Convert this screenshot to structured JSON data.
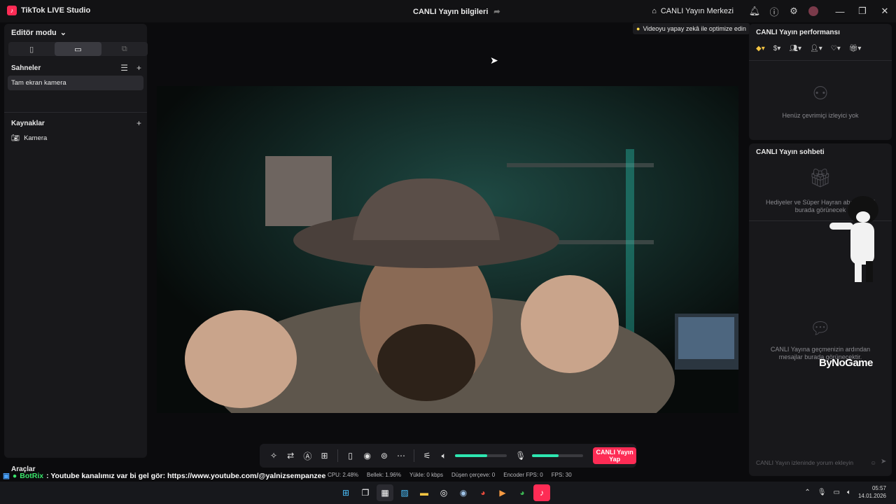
{
  "app": {
    "name": "TikTok LIVE Studio",
    "live_info_title": "CANLI Yayın bilgileri",
    "live_center_label": "CANLI Yayın Merkezi"
  },
  "left": {
    "editor_mode_label": "Editör modu",
    "scenes_label": "Sahneler",
    "scene_items": [
      "Tam ekran kamera"
    ],
    "sources_label": "Kaynaklar",
    "source_items": [
      "Kamera"
    ],
    "tools_label": "Araçlar"
  },
  "preview": {
    "ai_tip": "Videoyu yapay zekâ ile optimize edin"
  },
  "performance": {
    "title": "CANLI Yayın performansı",
    "empty_viewers": "Henüz çevrimiçi izleyici yok"
  },
  "chat": {
    "title": "CANLI Yayın sohbeti",
    "gifts_msg": "Hediyeler ve Süper Hayran abonelikleri burada görünecek",
    "messages_msg": "CANLI Yayına geçmenizin ardından mesajlar burada görünecektir.",
    "input_placeholder": "CANLI Yayın izleninde yorum ekleyin",
    "watermark": "ByNoGame"
  },
  "controls": {
    "go_live_label": "CANLI Yayın Yap",
    "speaker_level": 0.62,
    "mic_level": 0.52,
    "accent": "#fe2c55",
    "meter_color": "#2de6b0"
  },
  "ticker": {
    "user": "BotRix",
    "message": ": Youtube kanalımız var bi gel gör: https://www.youtube.com/@yalnizsempanzee"
  },
  "stats": {
    "cpu": "CPU: 2.48%",
    "memory": "Bellek: 1.96%",
    "upload": "Yükle: 0 kbps",
    "dropped": "Düşen çerçeve: 0",
    "encoder_fps": "Encoder FPS: 0",
    "fps": "FPS: 30"
  },
  "taskbar": {
    "time": "05:57",
    "date": "14.01.2026"
  }
}
